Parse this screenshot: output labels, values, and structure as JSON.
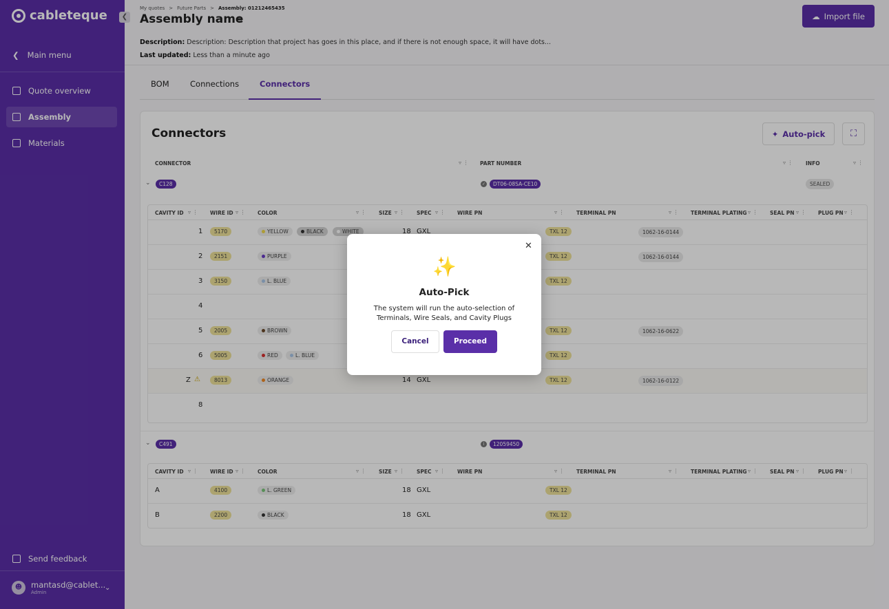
{
  "app": {
    "logo": "cableteque"
  },
  "sidebar": {
    "back_label": "Main menu",
    "items": [
      {
        "label": "Quote overview"
      },
      {
        "label": "Assembly"
      },
      {
        "label": "Materials"
      }
    ],
    "feedback_label": "Send feedback",
    "user": {
      "email": "mantasd@cablet...",
      "role": "Admin"
    }
  },
  "header": {
    "breadcrumb": [
      "My quotes",
      "Future Parts",
      "Assembly: 01212465435"
    ],
    "title": "Assembly name",
    "import_label": "Import file",
    "description_label": "Description:",
    "description_value": "Description: Description that project has goes in this place, and if there is not enough space, it will have dots...",
    "updated_label": "Last updated:",
    "updated_value": "Less than a minute ago"
  },
  "tabs": [
    {
      "label": "BOM"
    },
    {
      "label": "Connections"
    },
    {
      "label": "Connectors"
    }
  ],
  "card": {
    "title": "Connectors",
    "autopick_label": "Auto-pick",
    "columns": [
      "CONNECTOR",
      "PART NUMBER",
      "INFO"
    ],
    "sub_columns": [
      "CAVITY ID",
      "WIRE ID",
      "COLOR",
      "SIZE",
      "SPEC",
      "WIRE PN",
      "TERMINAL PN",
      "TERMINAL PLATING",
      "SEAL PN",
      "PLUG PN"
    ],
    "groups": [
      {
        "connector": "C128",
        "part_number": "DT06-08SA-CE10",
        "info": "SEALED",
        "rows": [
          {
            "cavity": "1",
            "wire": "5170",
            "colors": [
              "YELLOW",
              "BLACK",
              "WHITE"
            ],
            "size": "18",
            "spec": "GXL",
            "terminal": "TXL 12",
            "terminal_pn": "1062-16-0144"
          },
          {
            "cavity": "2",
            "wire": "2151",
            "colors": [
              "PURPLE"
            ],
            "size": "",
            "spec": "",
            "terminal": "TXL 12",
            "terminal_pn": "1062-16-0144"
          },
          {
            "cavity": "3",
            "wire": "3150",
            "colors": [
              "L. BLUE"
            ],
            "size": "",
            "spec": "",
            "terminal": "TXL 12",
            "terminal_pn": ""
          },
          {
            "cavity": "4",
            "wire": "",
            "colors": [],
            "size": "",
            "spec": "",
            "terminal": "",
            "terminal_pn": ""
          },
          {
            "cavity": "5",
            "wire": "2005",
            "colors": [
              "BROWN"
            ],
            "size": "",
            "spec": "",
            "terminal": "TXL 12",
            "terminal_pn": "1062-16-0622"
          },
          {
            "cavity": "6",
            "wire": "5005",
            "colors": [
              "RED",
              "L. BLUE"
            ],
            "size": "",
            "spec": "",
            "terminal": "TXL 12",
            "terminal_pn": ""
          },
          {
            "cavity": "Z",
            "wire": "8013",
            "colors": [
              "ORANGE"
            ],
            "size": "14",
            "spec": "GXL",
            "terminal": "TXL 12",
            "terminal_pn": "1062-16-0122"
          },
          {
            "cavity": "8",
            "wire": "",
            "colors": [],
            "size": "",
            "spec": "",
            "terminal": "",
            "terminal_pn": ""
          }
        ]
      },
      {
        "connector": "C491",
        "part_number": "12059450",
        "rows": [
          {
            "cavity": "A",
            "wire": "4100",
            "colors": [
              "L. GREEN"
            ],
            "size": "18",
            "spec": "GXL",
            "terminal": "TXL 12"
          },
          {
            "cavity": "B",
            "wire": "2200",
            "colors": [
              "BLACK"
            ],
            "size": "18",
            "spec": "GXL",
            "terminal": "TXL 12"
          }
        ]
      }
    ]
  },
  "modal": {
    "title": "Auto-Pick",
    "text": "The system will run the auto-selection of Terminals, Wire Seals, and Cavity Plugs",
    "cancel_label": "Cancel",
    "proceed_label": "Proceed"
  },
  "colors": {
    "brand": "#5a2fa8",
    "wire_pill": "#efe29a",
    "sparkle": "#f2c53d"
  }
}
